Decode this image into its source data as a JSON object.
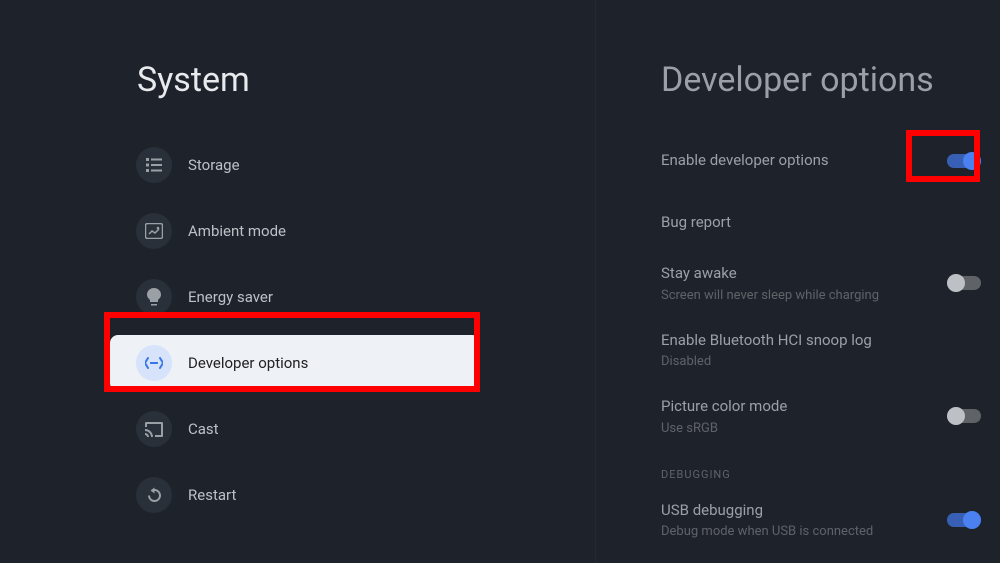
{
  "left": {
    "title": "System",
    "items": [
      {
        "label": "Storage",
        "icon": "list-icon",
        "selected": false
      },
      {
        "label": "Ambient mode",
        "icon": "ambient-icon",
        "selected": false
      },
      {
        "label": "Energy saver",
        "icon": "bulb-icon",
        "selected": false
      },
      {
        "label": "Developer options",
        "icon": "developer-icon",
        "selected": true
      },
      {
        "label": "Cast",
        "icon": "cast-icon",
        "selected": false
      },
      {
        "label": "Restart",
        "icon": "restart-icon",
        "selected": false
      }
    ]
  },
  "right": {
    "title": "Developer options",
    "items": [
      {
        "title": "Enable developer options",
        "sub": "",
        "toggle": "on"
      },
      {
        "title": "Bug report",
        "sub": "",
        "toggle": null
      },
      {
        "title": "Stay awake",
        "sub": "Screen will never sleep while charging",
        "toggle": "off"
      },
      {
        "title": "Enable Bluetooth HCI snoop log",
        "sub": "Disabled",
        "toggle": null
      },
      {
        "title": "Picture color mode",
        "sub": "Use sRGB",
        "toggle": "off"
      },
      {
        "section": "DEBUGGING"
      },
      {
        "title": "USB debugging",
        "sub": "Debug mode when USB is connected",
        "toggle": "on"
      }
    ]
  }
}
